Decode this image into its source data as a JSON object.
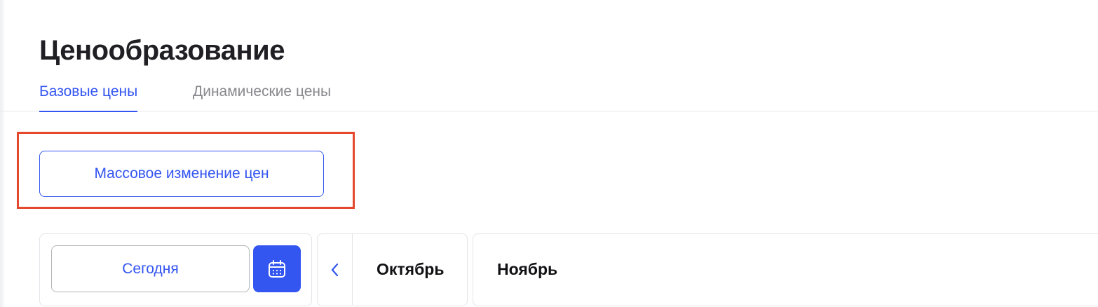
{
  "header": {
    "title": "Ценообразование"
  },
  "tabs": [
    {
      "label": "Базовые цены",
      "active": true
    },
    {
      "label": "Динамические цены",
      "active": false
    }
  ],
  "actions": {
    "mass_change_label": "Массовое изменение цен"
  },
  "calendar": {
    "today_label": "Сегодня",
    "calendar_icon": "calendar-icon",
    "prev_icon": "chevron-left-icon",
    "months": [
      "Октябрь",
      "Ноябрь"
    ]
  },
  "colors": {
    "accent": "#3355f0",
    "highlight": "#e4492d",
    "border": "#e4e5e9"
  }
}
